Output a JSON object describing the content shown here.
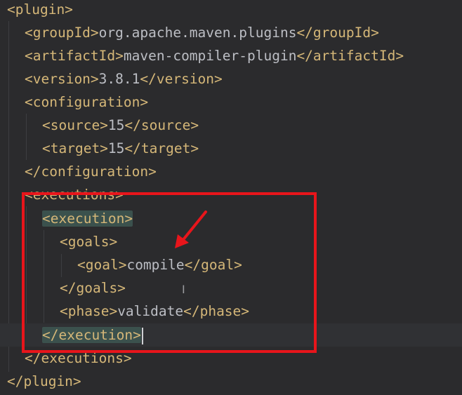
{
  "code_lines": [
    {
      "open": "<plugin>"
    },
    {
      "open": "<groupId>",
      "value": "org.apache.maven.plugins",
      "close": "</groupId>"
    },
    {
      "open": "<artifactId>",
      "value": "maven-compiler-plugin",
      "close": "</artifactId>"
    },
    {
      "open": "<version>",
      "value": "3.8.1",
      "close": "</version>"
    },
    {
      "open": "<configuration>"
    },
    {
      "open": "<source>",
      "value": "15",
      "close": "</source>"
    },
    {
      "open": "<target>",
      "value": "15",
      "close": "</target>"
    },
    {
      "open": "</configuration>"
    },
    {
      "open": "<executions>"
    },
    {
      "open": "<execution>"
    },
    {
      "open": "<goals>"
    },
    {
      "open": "<goal>",
      "value": "compile",
      "close": "</goal>"
    },
    {
      "open": "</goals>"
    },
    {
      "open": "<phase>",
      "value": "validate",
      "close": "</phase>"
    },
    {
      "open": "</execution>"
    },
    {
      "open": "</executions>"
    },
    {
      "open": "</plugin>"
    }
  ],
  "colors": {
    "background": "#2b2b2d",
    "tag": "#d5b778",
    "text": "#bcbec4",
    "annotation": "#e8151b",
    "tag_match_highlight": "#3b514d"
  },
  "icons": {
    "text_cursor": "i-beam-icon",
    "annotation_arrow": "red-arrow-icon"
  }
}
